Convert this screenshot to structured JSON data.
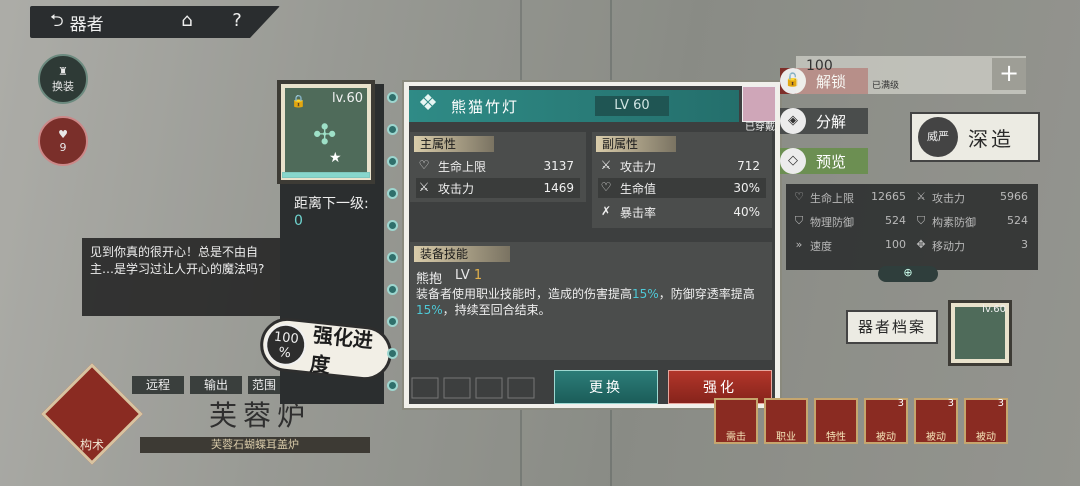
{
  "header": {
    "back_label": "器者",
    "home_icon": "home-icon",
    "help_icon": "help-icon"
  },
  "left_buttons": {
    "change_label": "换装",
    "favor_count": "9"
  },
  "dialogue": {
    "text": "见到你真的很开心！总是不由自主…是学习过让人开心的魔法吗?"
  },
  "character": {
    "tags": [
      "远程",
      "输出",
      "范围"
    ],
    "name": "芙蓉炉",
    "subtitle": "芙蓉石蝴蝶耳盖炉",
    "emblem_label": "构术"
  },
  "progress_badge": {
    "percent": "100",
    "percent_sign": "%",
    "label": "强化进度"
  },
  "item_card": {
    "level": "lv.60",
    "progress_fraction": 1.0,
    "next_level_label": "距离下一级:",
    "next_level_value": "0"
  },
  "dialog": {
    "title": "熊猫竹灯",
    "level": "LV 60",
    "equipped_label": "已穿戴",
    "main_attr": {
      "header": "主属性",
      "rows": [
        {
          "icon": "heart-icon",
          "name": "生命上限",
          "value": "3137"
        },
        {
          "icon": "swords-icon",
          "name": "攻击力",
          "value": "1469"
        }
      ]
    },
    "sub_attr": {
      "header": "副属性",
      "rows": [
        {
          "icon": "swords-icon",
          "name": "攻击力",
          "value": "712"
        },
        {
          "icon": "heart-icon",
          "name": "生命值",
          "value": "30%"
        },
        {
          "icon": "crit-icon",
          "name": "暴击率",
          "value": "40%"
        }
      ]
    },
    "skill": {
      "header": "装备技能",
      "name": "熊抱",
      "lv_prefix": "LV",
      "lv": "1",
      "desc_part1": "装备者使用职业技能时，造成的伤害提高",
      "hl1": "15%",
      "desc_part2": "，防御穿透率提高",
      "hl2": "15%",
      "desc_part3": "，持续至回合结束。"
    },
    "replace_label": "更换",
    "enhance_label": "强化"
  },
  "side_buttons": {
    "unlock": "解锁",
    "decompose": "分解",
    "preview": "预览"
  },
  "right_panel": {
    "deep_label": "深造",
    "deep_icon_label": "威严",
    "stats": [
      {
        "name": "生命上限",
        "value": "12665",
        "name2": "攻击力",
        "value2": "5966"
      },
      {
        "name": "物理防御",
        "value": "524",
        "name2": "构素防御",
        "value2": "524"
      },
      {
        "name": "速度",
        "value": "100",
        "name2": "移动力",
        "value2": "3"
      }
    ],
    "archive_label": "器者档案",
    "item_level": "lv.60",
    "skill_icons": [
      {
        "label": "需击",
        "count": ""
      },
      {
        "label": "职业",
        "count": ""
      },
      {
        "label": "特性",
        "count": ""
      },
      {
        "label": "被动",
        "count": "3"
      },
      {
        "label": "被动",
        "count": "3"
      },
      {
        "label": "被动",
        "count": "3"
      }
    ],
    "top_count": "100",
    "top_note": "已满级"
  },
  "colors": {
    "teal": "#2f8b86",
    "red": "#b2362a",
    "highlight": "#4ec8d6",
    "gold": "#e1b04b"
  }
}
